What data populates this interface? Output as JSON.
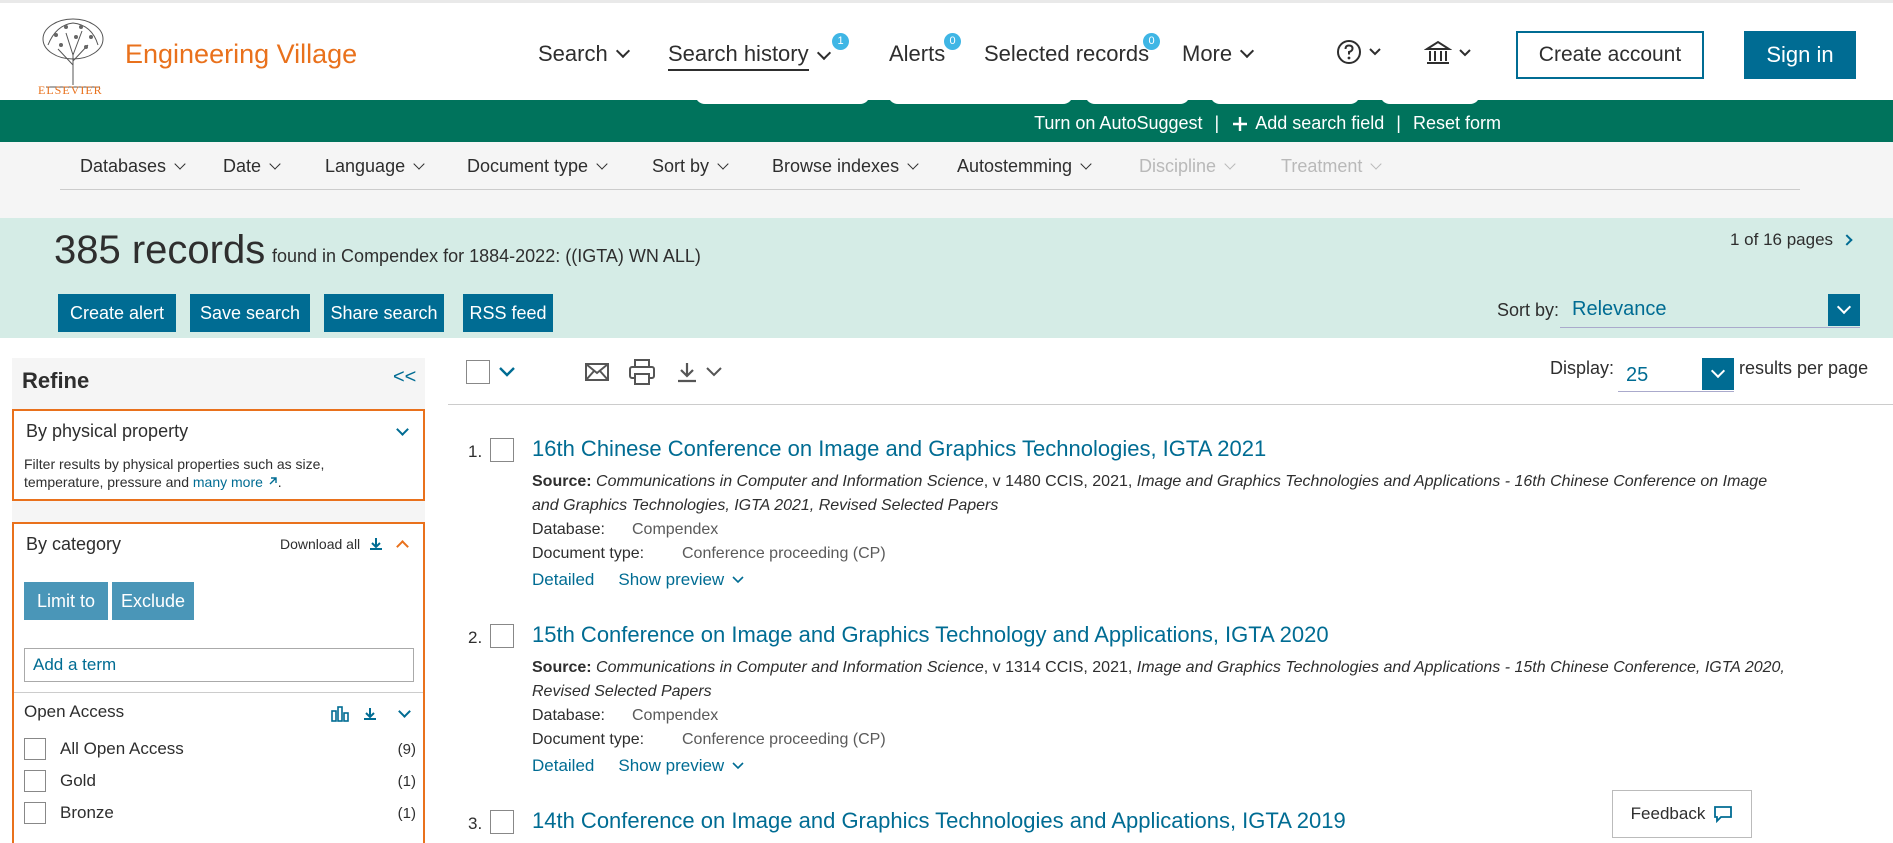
{
  "header": {
    "brand": "Engineering Village",
    "logo_text": "ELSEVIER",
    "nav": [
      {
        "label": "Search"
      },
      {
        "label": "Search history",
        "badge": "1"
      },
      {
        "label": "Alerts",
        "badge": "0"
      },
      {
        "label": "Selected records",
        "badge": "0"
      },
      {
        "label": "More"
      }
    ],
    "create_account": "Create account",
    "sign_in": "Sign in"
  },
  "search_bar": {
    "autosuggest": "Turn on AutoSuggest",
    "add_field": "Add search field",
    "reset": "Reset form",
    "separator": "|"
  },
  "filters": [
    "Databases",
    "Date",
    "Language",
    "Document type",
    "Sort by",
    "Browse indexes",
    "Autostemming",
    "Discipline",
    "Treatment"
  ],
  "results": {
    "count": "385 records",
    "found_text": "found in Compendex for 1884-2022: ((IGTA) WN ALL)",
    "pager": "1 of 16 pages",
    "actions": [
      "Create alert",
      "Save search",
      "Share search",
      "RSS feed"
    ],
    "sort_label": "Sort by:",
    "sort_value": "Relevance",
    "display_label": "Display:",
    "display_value": "25",
    "per_page": "results per page"
  },
  "refine": {
    "title": "Refine",
    "collapse": "<<",
    "physical": {
      "title": "By physical property",
      "desc": "Filter results by physical properties such as size, temperature, pressure and",
      "more_link": "many more",
      "period": "."
    },
    "category": {
      "title": "By category",
      "download_all": "Download all",
      "limit": "Limit to",
      "exclude": "Exclude",
      "term_placeholder": "Add a term"
    },
    "open_access": {
      "title": "Open Access",
      "items": [
        {
          "label": "All Open Access",
          "count": "(9)"
        },
        {
          "label": "Gold",
          "count": "(1)"
        },
        {
          "label": "Bronze",
          "count": "(1)"
        }
      ]
    }
  },
  "records": [
    {
      "num": "1.",
      "title": "16th Chinese Conference on Image and Graphics Technologies, IGTA 2021",
      "source_label": "Source:",
      "source_a": "Communications in Computer and Information Science",
      "source_b": ", v 1480 CCIS, 2021, ",
      "source_c": "Image and Graphics Technologies and Applications - 16th Chinese Conference on Image and Graphics Technologies, IGTA 2021, Revised Selected Papers",
      "db_label": "Database:",
      "db": "Compendex",
      "doctype_label": "Document type:",
      "doctype": "Conference proceeding (CP)",
      "detailed": "Detailed",
      "preview": "Show preview"
    },
    {
      "num": "2.",
      "title": "15th Conference on Image and Graphics Technology and Applications, IGTA 2020",
      "source_label": "Source:",
      "source_a": "Communications in Computer and Information Science",
      "source_b": ", v 1314 CCIS, 2021, ",
      "source_c": "Image and Graphics Technologies and Applications - 15th Chinese Conference, IGTA 2020, Revised Selected Papers",
      "db_label": "Database:",
      "db": "Compendex",
      "doctype_label": "Document type:",
      "doctype": "Conference proceeding (CP)",
      "detailed": "Detailed",
      "preview": "Show preview"
    },
    {
      "num": "3.",
      "title": "14th Conference on Image and Graphics Technologies and Applications, IGTA 2019"
    }
  ],
  "feedback": "Feedback",
  "colors": {
    "brand": "#e9711c",
    "primary": "#006c93",
    "green_bar": "#00735c",
    "banner": "#d5ece6",
    "badge": "#3fb6e5"
  },
  "icons": [
    "help-icon",
    "institution-icon",
    "plus-icon",
    "email-icon",
    "print-icon",
    "download-icon",
    "chart-icon",
    "external-link-icon",
    "chat-icon"
  ]
}
